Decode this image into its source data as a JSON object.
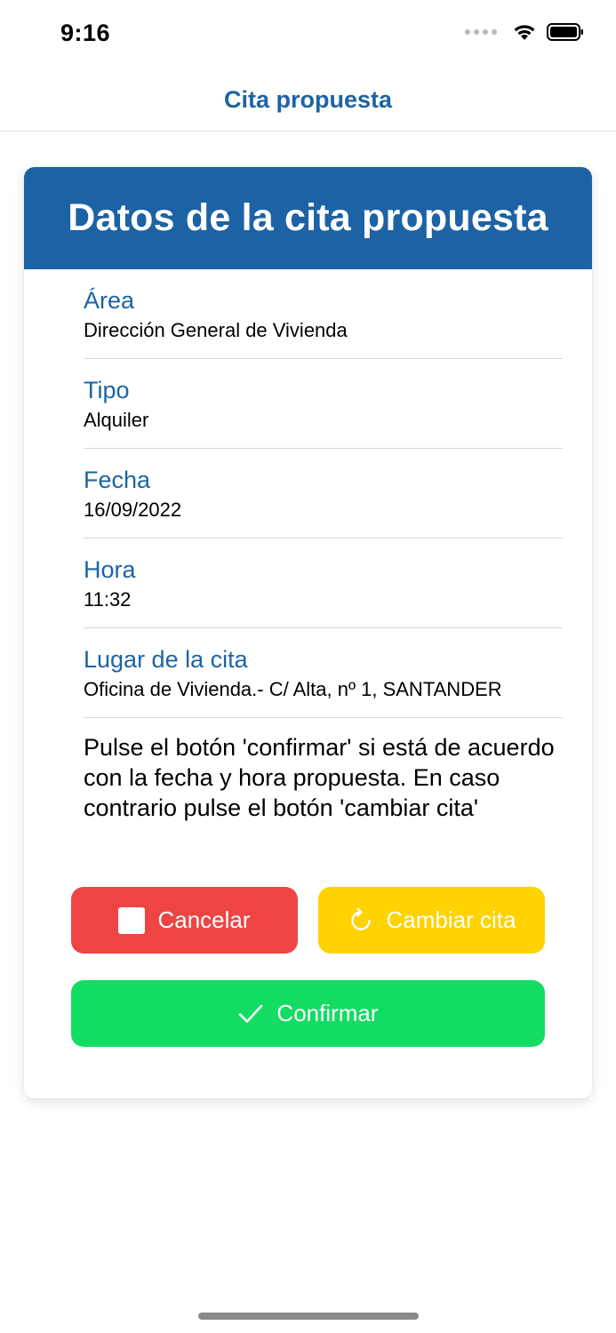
{
  "status_bar": {
    "time": "9:16",
    "icons": [
      "signal-dots-icon",
      "wifi-icon",
      "battery-icon"
    ]
  },
  "nav": {
    "title": "Cita propuesta"
  },
  "card": {
    "title": "Datos de la cita propuesta",
    "fields": [
      {
        "label": "Área",
        "value": "Dirección General de Vivienda"
      },
      {
        "label": "Tipo",
        "value": "Alquiler"
      },
      {
        "label": "Fecha",
        "value": "16/09/2022"
      },
      {
        "label": "Hora",
        "value": "11:32"
      },
      {
        "label": "Lugar de la cita",
        "value": "Oficina de Vivienda.- C/ Alta, nº 1, SANTANDER"
      }
    ],
    "instructions": "Pulse el botón 'confirmar' si está de acuerdo con la fecha y hora propuesta. En caso contrario pulse el botón 'cambiar cita'"
  },
  "buttons": {
    "cancel_label": "Cancelar",
    "change_label": "Cambiar cita",
    "confirm_label": "Confirmar"
  },
  "colors": {
    "primary_blue": "#1d62a4",
    "cancel_red": "#ef4444",
    "change_yellow": "#ffd200",
    "confirm_green": "#12dc62"
  }
}
